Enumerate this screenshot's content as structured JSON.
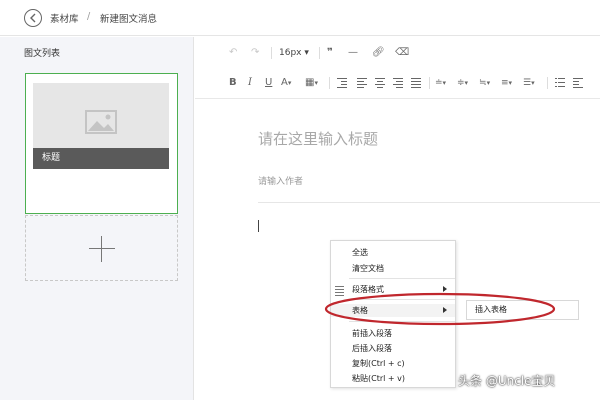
{
  "breadcrumb": {
    "library": "素材库",
    "separator": "/",
    "current": "新建图文消息"
  },
  "sidebar": {
    "title": "图文列表",
    "card_title": "标题"
  },
  "toolbar": {
    "font_size": "16px",
    "font_size_arrow": "▾",
    "bold": "B",
    "italic": "I",
    "underline": "U",
    "font_color": "A",
    "dropdown_arrow": "▾"
  },
  "editor": {
    "title_placeholder": "请在这里输入标题",
    "author_placeholder": "请输入作者"
  },
  "context_menu": {
    "items": [
      "全选",
      "清空文档",
      "段落格式",
      "表格",
      "前插入段落",
      "后插入段落",
      "复制(Ctrl + c)",
      "粘贴(Ctrl + v)"
    ],
    "submenu_item": "插入表格"
  },
  "watermark": "头条 @Uncle宝贝",
  "colors": {
    "card_border": "#4caf50",
    "highlight_ellipse": "#c0272d",
    "sidebar_bg": "#f4f5f9"
  },
  "icons": {
    "back": "back-icon",
    "image_placeholder": "image-placeholder-icon",
    "add": "plus-icon"
  }
}
